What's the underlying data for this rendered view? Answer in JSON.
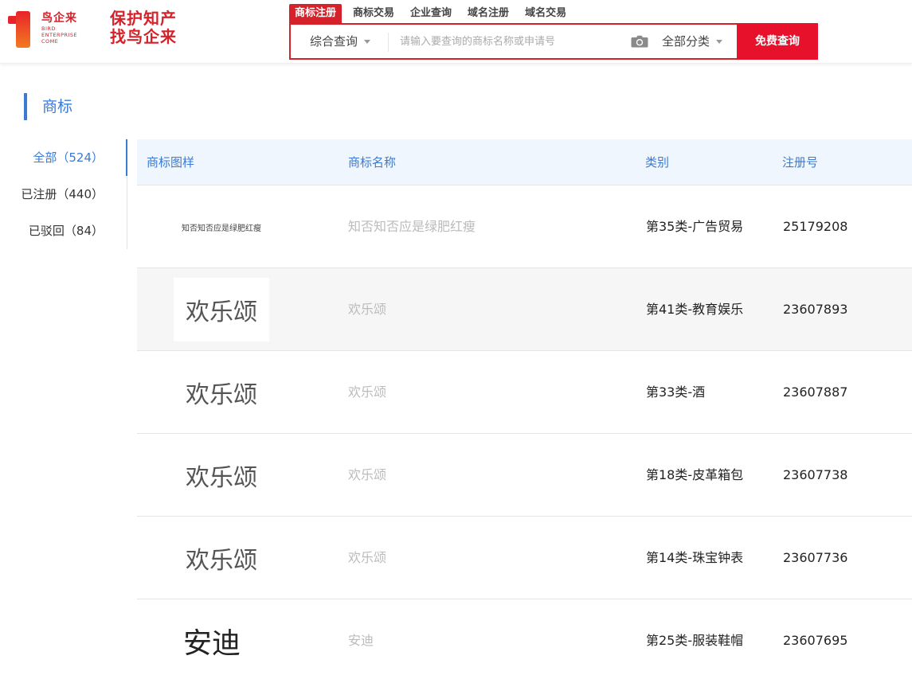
{
  "header": {
    "logo": {
      "cn": "鸟企来",
      "en_lines": [
        "BIRD",
        "ENTERPRISE",
        "COME"
      ]
    },
    "slogan_lines": [
      "保护知产",
      "找鸟企来"
    ],
    "tabs": [
      {
        "label": "商标注册",
        "active": true
      },
      {
        "label": "商标交易",
        "active": false
      },
      {
        "label": "企业查询",
        "active": false
      },
      {
        "label": "域名注册",
        "active": false
      },
      {
        "label": "域名交易",
        "active": false
      }
    ],
    "search": {
      "type_label": "综合查询",
      "placeholder": "请输入要查询的商标名称或申请号",
      "value": "",
      "category_label": "全部分类",
      "button_label": "免费查询"
    },
    "accent_color": "#d4212a"
  },
  "section": {
    "title": "商标"
  },
  "filters": [
    {
      "label": "全部（524）",
      "active": true
    },
    {
      "label": "已注册（440）",
      "active": false
    },
    {
      "label": "已驳回（84）",
      "active": false
    }
  ],
  "table": {
    "columns": [
      "商标图样",
      "商标名称",
      "类别",
      "注册号"
    ],
    "rows": [
      {
        "image_text": "知否知否应是绿肥红瘦",
        "name": "知否知否应是绿肥红瘦",
        "category": "第35类-广告贸易",
        "reg_no": "25179208"
      },
      {
        "image_text": "欢乐颂",
        "name": "欢乐颂",
        "category": "第41类-教育娱乐",
        "reg_no": "23607893"
      },
      {
        "image_text": "欢乐颂",
        "name": "欢乐颂",
        "category": "第33类-酒",
        "reg_no": "23607887"
      },
      {
        "image_text": "欢乐颂",
        "name": "欢乐颂",
        "category": "第18类-皮革箱包",
        "reg_no": "23607738"
      },
      {
        "image_text": "欢乐颂",
        "name": "欢乐颂",
        "category": "第14类-珠宝钟表",
        "reg_no": "23607736"
      },
      {
        "image_text": "安迪",
        "name": "安迪",
        "category": "第25类-服装鞋帽",
        "reg_no": "23607695"
      }
    ]
  }
}
